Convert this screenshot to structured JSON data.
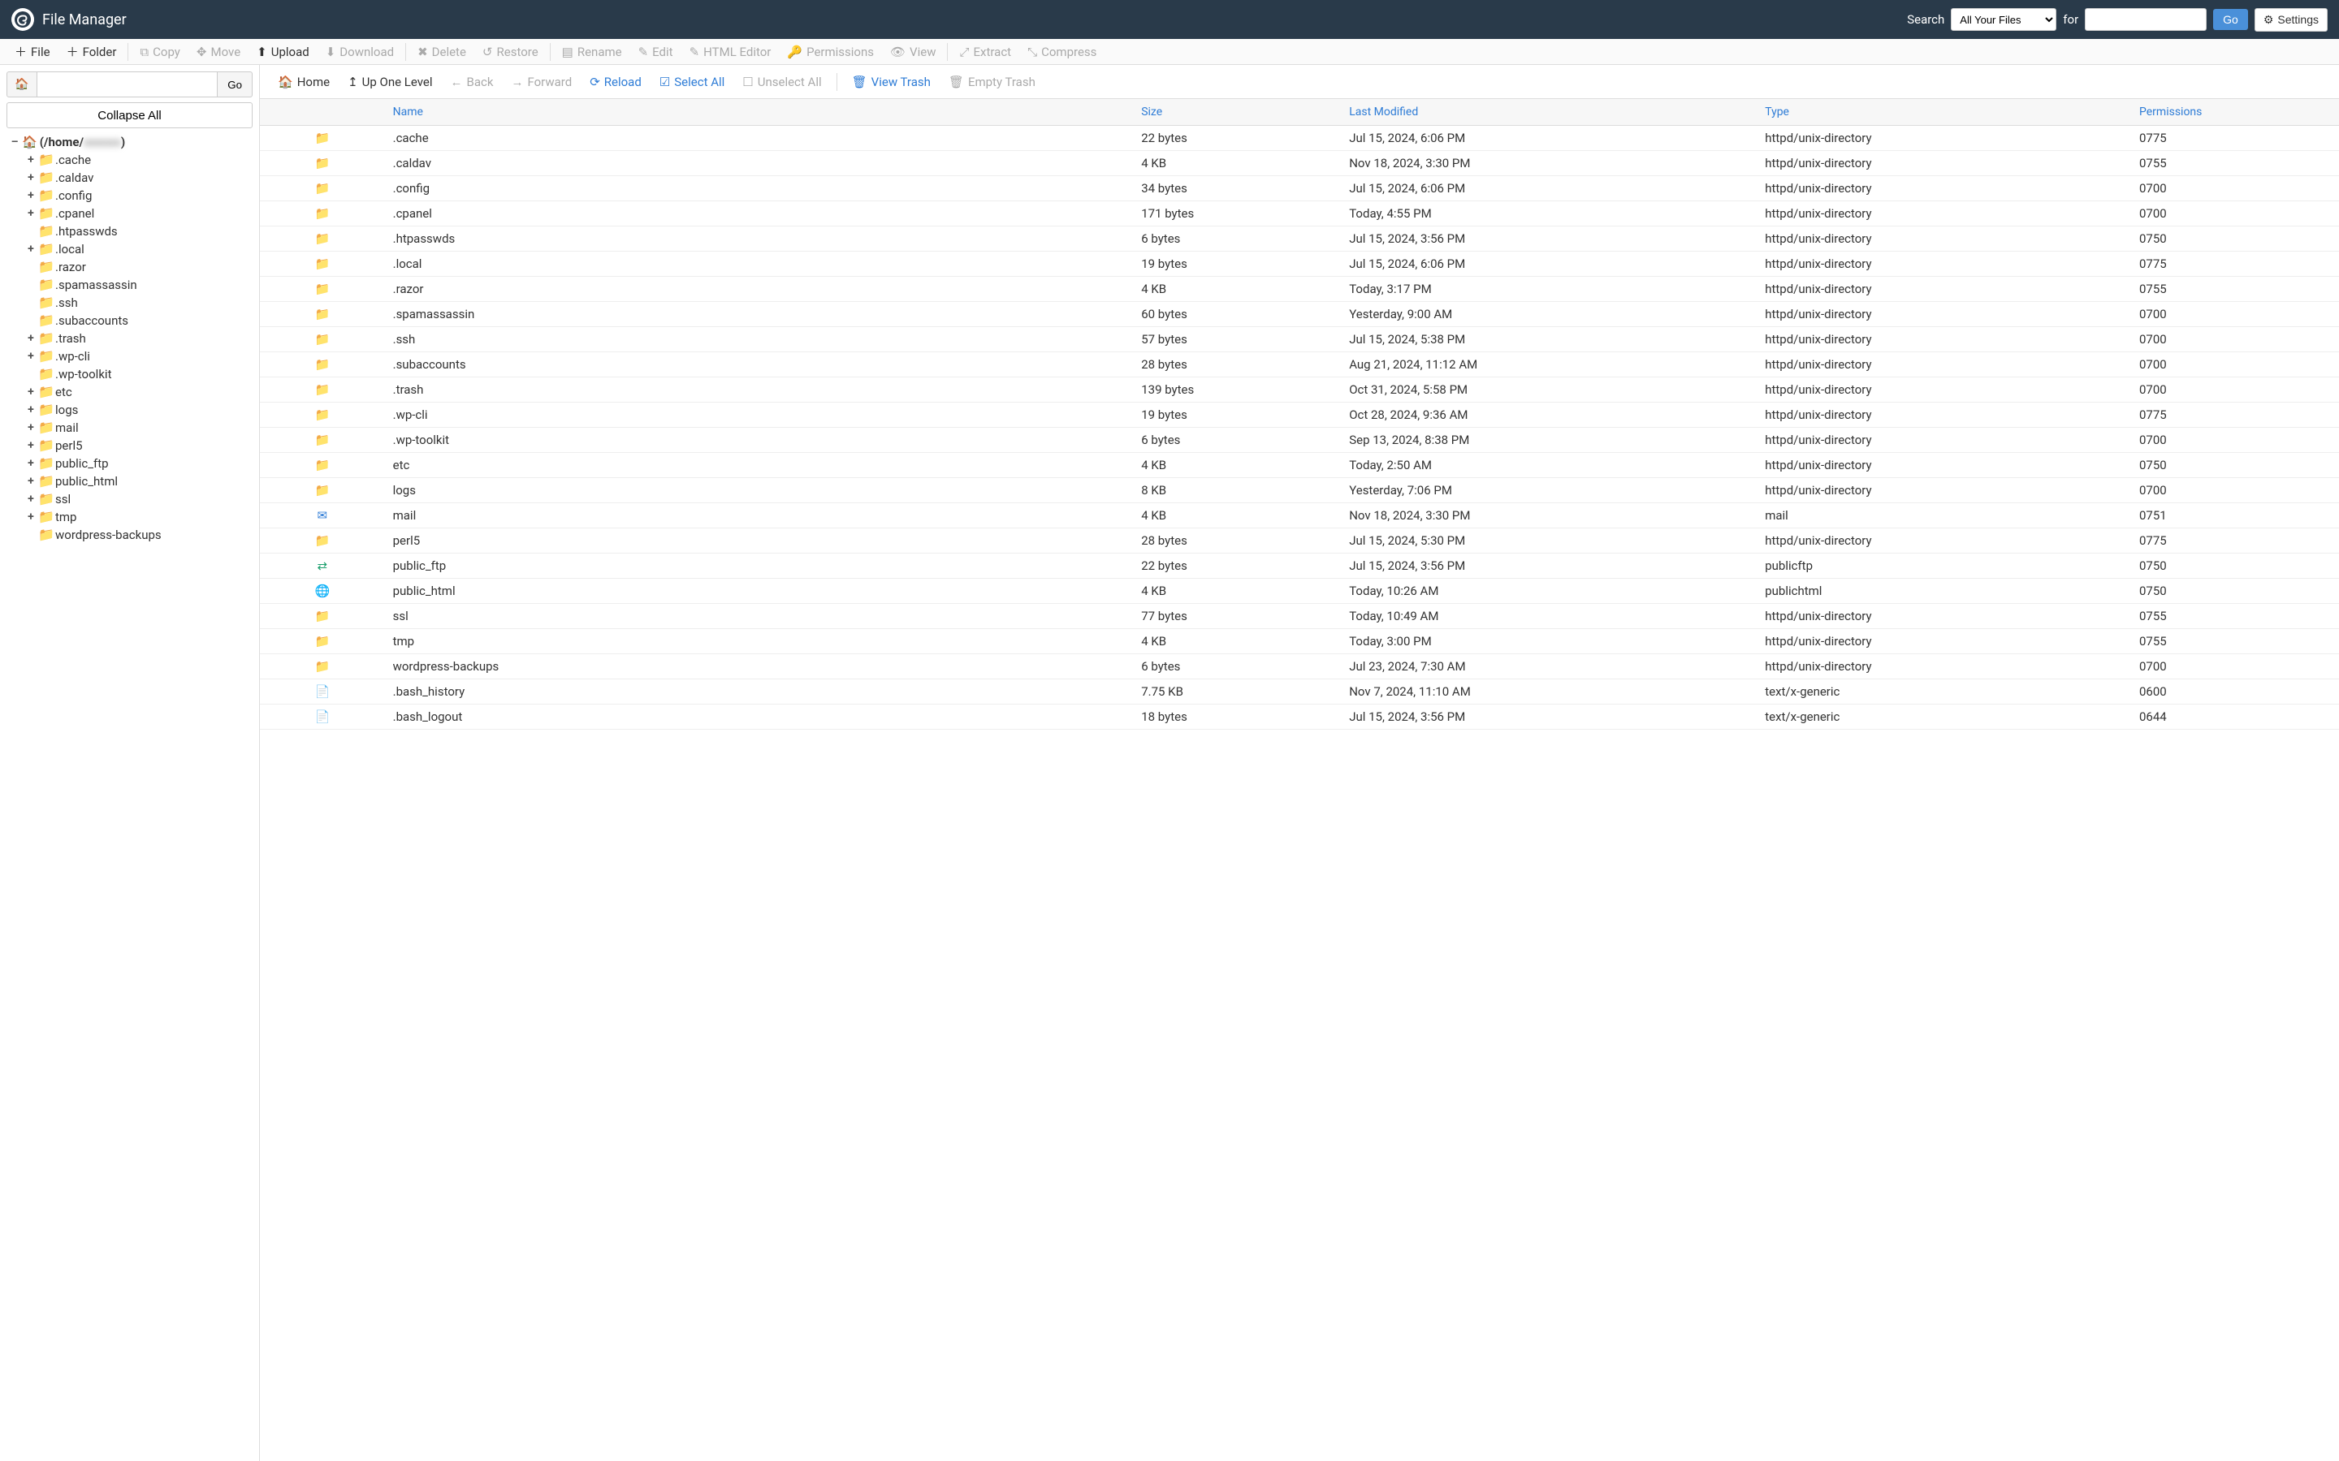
{
  "app": {
    "title": "File Manager"
  },
  "search": {
    "label": "Search",
    "scope_selected": "All Your Files",
    "for_label": "for",
    "input_value": "",
    "go_label": "Go",
    "settings_label": "Settings"
  },
  "toolbar": {
    "file": "File",
    "folder": "Folder",
    "copy": "Copy",
    "move": "Move",
    "upload": "Upload",
    "download": "Download",
    "delete": "Delete",
    "restore": "Restore",
    "rename": "Rename",
    "edit": "Edit",
    "html_editor": "HTML Editor",
    "permissions": "Permissions",
    "view": "View",
    "extract": "Extract",
    "compress": "Compress"
  },
  "pathbar": {
    "value": "",
    "go_label": "Go",
    "collapse_label": "Collapse All"
  },
  "tree": {
    "root_prefix": "(/home/",
    "root_blur": "xxxxxx",
    "root_suffix": ")",
    "children": [
      {
        "name": ".cache",
        "expandable": true
      },
      {
        "name": ".caldav",
        "expandable": true
      },
      {
        "name": ".config",
        "expandable": true
      },
      {
        "name": ".cpanel",
        "expandable": true
      },
      {
        "name": ".htpasswds",
        "expandable": false
      },
      {
        "name": ".local",
        "expandable": true
      },
      {
        "name": ".razor",
        "expandable": false
      },
      {
        "name": ".spamassassin",
        "expandable": false
      },
      {
        "name": ".ssh",
        "expandable": false
      },
      {
        "name": ".subaccounts",
        "expandable": false
      },
      {
        "name": ".trash",
        "expandable": true
      },
      {
        "name": ".wp-cli",
        "expandable": true
      },
      {
        "name": ".wp-toolkit",
        "expandable": false
      },
      {
        "name": "etc",
        "expandable": true
      },
      {
        "name": "logs",
        "expandable": true
      },
      {
        "name": "mail",
        "expandable": true
      },
      {
        "name": "perl5",
        "expandable": true
      },
      {
        "name": "public_ftp",
        "expandable": true
      },
      {
        "name": "public_html",
        "expandable": true
      },
      {
        "name": "ssl",
        "expandable": true
      },
      {
        "name": "tmp",
        "expandable": true
      },
      {
        "name": "wordpress-backups",
        "expandable": false
      }
    ]
  },
  "nav": {
    "home": "Home",
    "up": "Up One Level",
    "back": "Back",
    "forward": "Forward",
    "reload": "Reload",
    "select_all": "Select All",
    "unselect_all": "Unselect All",
    "view_trash": "View Trash",
    "empty_trash": "Empty Trash"
  },
  "columns": {
    "name": "Name",
    "size": "Size",
    "modified": "Last Modified",
    "type": "Type",
    "permissions": "Permissions"
  },
  "rows": [
    {
      "icon": "folder",
      "name": ".cache",
      "size": "22 bytes",
      "modified": "Jul 15, 2024, 6:06 PM",
      "type": "httpd/unix-directory",
      "perm": "0775"
    },
    {
      "icon": "folder",
      "name": ".caldav",
      "size": "4 KB",
      "modified": "Nov 18, 2024, 3:30 PM",
      "type": "httpd/unix-directory",
      "perm": "0755"
    },
    {
      "icon": "folder",
      "name": ".config",
      "size": "34 bytes",
      "modified": "Jul 15, 2024, 6:06 PM",
      "type": "httpd/unix-directory",
      "perm": "0700"
    },
    {
      "icon": "folder",
      "name": ".cpanel",
      "size": "171 bytes",
      "modified": "Today, 4:55 PM",
      "type": "httpd/unix-directory",
      "perm": "0700"
    },
    {
      "icon": "folder",
      "name": ".htpasswds",
      "size": "6 bytes",
      "modified": "Jul 15, 2024, 3:56 PM",
      "type": "httpd/unix-directory",
      "perm": "0750"
    },
    {
      "icon": "folder",
      "name": ".local",
      "size": "19 bytes",
      "modified": "Jul 15, 2024, 6:06 PM",
      "type": "httpd/unix-directory",
      "perm": "0775"
    },
    {
      "icon": "folder",
      "name": ".razor",
      "size": "4 KB",
      "modified": "Today, 3:17 PM",
      "type": "httpd/unix-directory",
      "perm": "0755"
    },
    {
      "icon": "folder",
      "name": ".spamassassin",
      "size": "60 bytes",
      "modified": "Yesterday, 9:00 AM",
      "type": "httpd/unix-directory",
      "perm": "0700"
    },
    {
      "icon": "folder",
      "name": ".ssh",
      "size": "57 bytes",
      "modified": "Jul 15, 2024, 5:38 PM",
      "type": "httpd/unix-directory",
      "perm": "0700"
    },
    {
      "icon": "folder",
      "name": ".subaccounts",
      "size": "28 bytes",
      "modified": "Aug 21, 2024, 11:12 AM",
      "type": "httpd/unix-directory",
      "perm": "0700"
    },
    {
      "icon": "folder",
      "name": ".trash",
      "size": "139 bytes",
      "modified": "Oct 31, 2024, 5:58 PM",
      "type": "httpd/unix-directory",
      "perm": "0700"
    },
    {
      "icon": "folder",
      "name": ".wp-cli",
      "size": "19 bytes",
      "modified": "Oct 28, 2024, 9:36 AM",
      "type": "httpd/unix-directory",
      "perm": "0775"
    },
    {
      "icon": "folder",
      "name": ".wp-toolkit",
      "size": "6 bytes",
      "modified": "Sep 13, 2024, 8:38 PM",
      "type": "httpd/unix-directory",
      "perm": "0700"
    },
    {
      "icon": "folder",
      "name": "etc",
      "size": "4 KB",
      "modified": "Today, 2:50 AM",
      "type": "httpd/unix-directory",
      "perm": "0750"
    },
    {
      "icon": "folder",
      "name": "logs",
      "size": "8 KB",
      "modified": "Yesterday, 7:06 PM",
      "type": "httpd/unix-directory",
      "perm": "0700"
    },
    {
      "icon": "mail",
      "name": "mail",
      "size": "4 KB",
      "modified": "Nov 18, 2024, 3:30 PM",
      "type": "mail",
      "perm": "0751"
    },
    {
      "icon": "folder",
      "name": "perl5",
      "size": "28 bytes",
      "modified": "Jul 15, 2024, 5:30 PM",
      "type": "httpd/unix-directory",
      "perm": "0775"
    },
    {
      "icon": "ftp",
      "name": "public_ftp",
      "size": "22 bytes",
      "modified": "Jul 15, 2024, 3:56 PM",
      "type": "publicftp",
      "perm": "0750"
    },
    {
      "icon": "html",
      "name": "public_html",
      "size": "4 KB",
      "modified": "Today, 10:26 AM",
      "type": "publichtml",
      "perm": "0750"
    },
    {
      "icon": "folder",
      "name": "ssl",
      "size": "77 bytes",
      "modified": "Today, 10:49 AM",
      "type": "httpd/unix-directory",
      "perm": "0755"
    },
    {
      "icon": "folder",
      "name": "tmp",
      "size": "4 KB",
      "modified": "Today, 3:00 PM",
      "type": "httpd/unix-directory",
      "perm": "0755"
    },
    {
      "icon": "folder",
      "name": "wordpress-backups",
      "size": "6 bytes",
      "modified": "Jul 23, 2024, 7:30 AM",
      "type": "httpd/unix-directory",
      "perm": "0700"
    },
    {
      "icon": "file",
      "name": ".bash_history",
      "size": "7.75 KB",
      "modified": "Nov 7, 2024, 11:10 AM",
      "type": "text/x-generic",
      "perm": "0600"
    },
    {
      "icon": "file",
      "name": ".bash_logout",
      "size": "18 bytes",
      "modified": "Jul 15, 2024, 3:56 PM",
      "type": "text/x-generic",
      "perm": "0644"
    }
  ]
}
